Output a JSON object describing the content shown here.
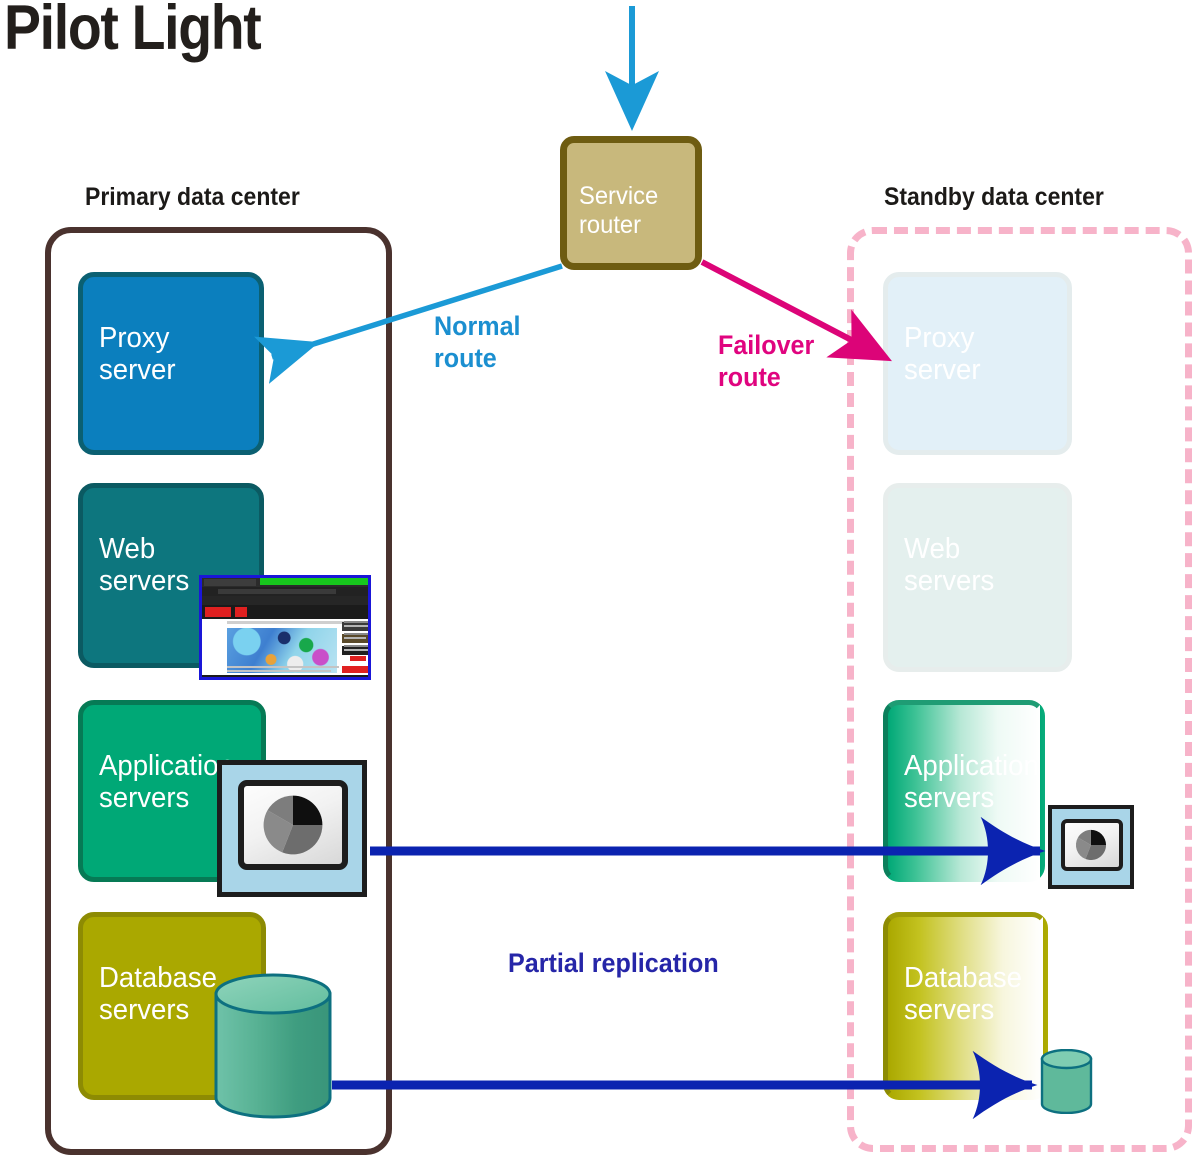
{
  "title": "Pilot Light",
  "primary_center": {
    "caption": "Primary data center",
    "boxes": [
      {
        "label": "Proxy\nserver",
        "color": "#0b7fbe"
      },
      {
        "label": "Web\nservers",
        "color": "#0d767e"
      },
      {
        "label": "Application\nservers",
        "color": "#00a876"
      },
      {
        "label": "Database\nservers",
        "color": "#aaa800"
      }
    ]
  },
  "standby_center": {
    "caption": "Standby data center",
    "border_color": "#f7b3c9",
    "boxes": [
      {
        "label": "Proxy\nserver",
        "state": "faded"
      },
      {
        "label": "Web\nservers",
        "state": "faded"
      },
      {
        "label": "Application\nservers",
        "state": "partial"
      },
      {
        "label": "Database\nservers",
        "state": "partial"
      }
    ]
  },
  "router": {
    "label": "Service\nrouter",
    "fill": "#c8b87c",
    "stroke": "#6e5c11"
  },
  "routes": {
    "normal": {
      "label": "Normal\nroute",
      "color": "#1b8fd0"
    },
    "failover": {
      "label": "Failover\nroute",
      "color": "#e0047f"
    },
    "replication": {
      "label": "Partial replication",
      "color": "#2626a8"
    }
  },
  "icons": {
    "app_monitor": "monitor-pie-chart-icon",
    "database": "database-cylinder-icon",
    "browser_thumbnail": "browser-window-screenshot"
  }
}
